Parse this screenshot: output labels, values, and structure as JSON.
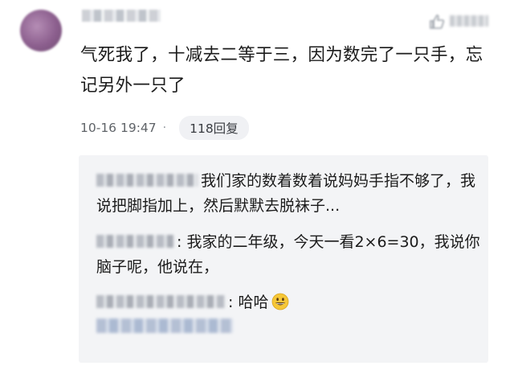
{
  "comment": {
    "text": "气死我了，十减去二等于三，因为数完了一只手，忘记另外一只了",
    "timestamp": "10-16 19:47",
    "separator": "·",
    "reply_count_label": "118回复"
  },
  "replies": [
    {
      "text": "我们家的数着数着说妈妈手指不够了，我说把脚指加上，然后默默去脱袜子..."
    },
    {
      "text": ": 我家的二年级，今天一看2×6=30，我说你脑子呢，他说在，"
    },
    {
      "text": ": 哈哈",
      "emoji": "grinning-face"
    }
  ],
  "view_all_label": "",
  "colors": {
    "panel_bg": "#f3f4f6",
    "reply_button_bg": "#f0f1f4",
    "emoji_fill": "#f6c737"
  }
}
